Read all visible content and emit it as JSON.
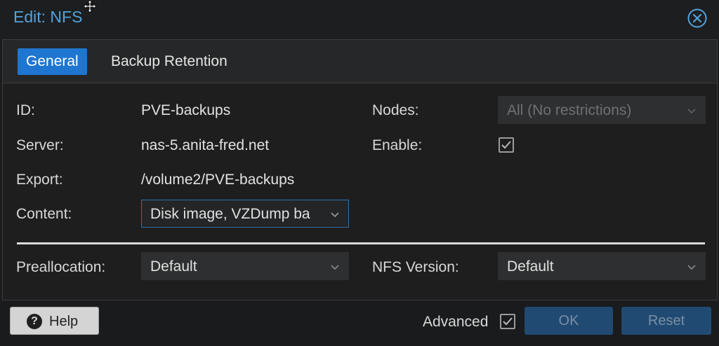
{
  "dialog": {
    "title": "Edit: NFS"
  },
  "tabs": [
    {
      "label": "General",
      "active": true
    },
    {
      "label": "Backup Retention",
      "active": false
    }
  ],
  "fields": {
    "id": {
      "label": "ID:",
      "value": "PVE-backups"
    },
    "server": {
      "label": "Server:",
      "value": "nas-5.anita-fred.net"
    },
    "export": {
      "label": "Export:",
      "value": "/volume2/PVE-backups"
    },
    "content": {
      "label": "Content:",
      "value": "Disk image, VZDump ba"
    },
    "nodes": {
      "label": "Nodes:",
      "value": "All (No restrictions)"
    },
    "enable": {
      "label": "Enable:",
      "checked": true
    },
    "preallocation": {
      "label": "Preallocation:",
      "value": "Default"
    },
    "nfs_version": {
      "label": "NFS Version:",
      "value": "Default"
    }
  },
  "footer": {
    "help_label": "Help",
    "advanced_label": "Advanced",
    "advanced_checked": true,
    "ok_label": "OK",
    "reset_label": "Reset"
  },
  "colors": {
    "accent": "#1e76d0",
    "title": "#4ea3df",
    "button_disabled_bg": "#204a72"
  },
  "icons": {
    "close": "close-circle-icon",
    "help": "question-circle-icon",
    "dropdown": "chevron-down-icon",
    "check": "checkmark-icon",
    "cursor": "move-cursor-icon"
  }
}
